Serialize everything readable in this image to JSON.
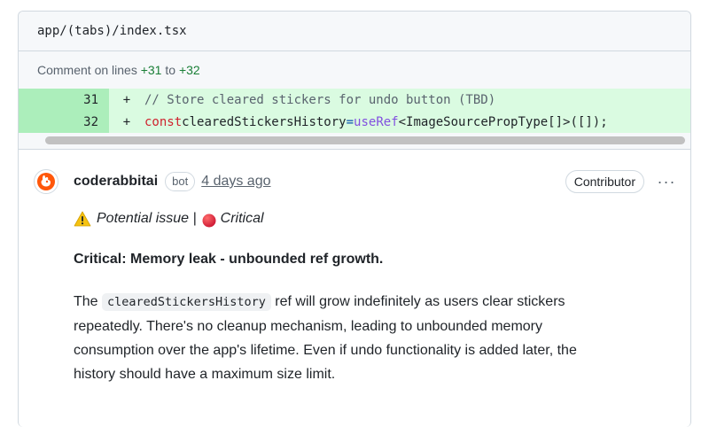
{
  "file": {
    "path": "app/(tabs)/index.tsx"
  },
  "comment_on": {
    "prefix": "Comment on lines",
    "start": "+31",
    "joiner": "to",
    "end": "+32"
  },
  "diff": {
    "rows": [
      {
        "line": "31",
        "marker": "+",
        "tokens": [
          "// Store cleared stickers for undo button (TBD)"
        ]
      },
      {
        "line": "32",
        "marker": "+",
        "tokens": [
          "const",
          "clearedStickersHistory",
          "=",
          "useRef",
          "<ImageSourcePropType[]>",
          "([]);"
        ]
      }
    ]
  },
  "comment": {
    "author": "coderabbitai",
    "bot_label": "bot",
    "timestamp": "4 days ago",
    "role_badge": "Contributor",
    "more_label": "···",
    "potential_issue": "Potential issue |",
    "severity": "Critical",
    "heading": "Critical: Memory leak - unbounded ref growth.",
    "para_prefix": "The",
    "para_code": "clearedStickersHistory",
    "para_line1_rest": "ref will grow indefinitely as users clear stickers",
    "para_line2": "repeatedly. There's no cleanup mechanism, leading to unbounded memory",
    "para_line3": "consumption over the app's lifetime. Even if undo functionality is added later, the",
    "para_line4": "history should have a maximum size limit."
  },
  "colors": {
    "added_line_number_bg": "#aceebb",
    "added_code_bg": "#dafbe1",
    "keyword": "#cf222e",
    "function": "#8250df",
    "operator": "#0550ae",
    "added_number_text": "#1a7f37"
  },
  "icons": {
    "avatar": "coderabbit-avatar-icon",
    "warning": "warning-icon",
    "critical": "red-circle-icon",
    "more": "kebab-icon"
  }
}
